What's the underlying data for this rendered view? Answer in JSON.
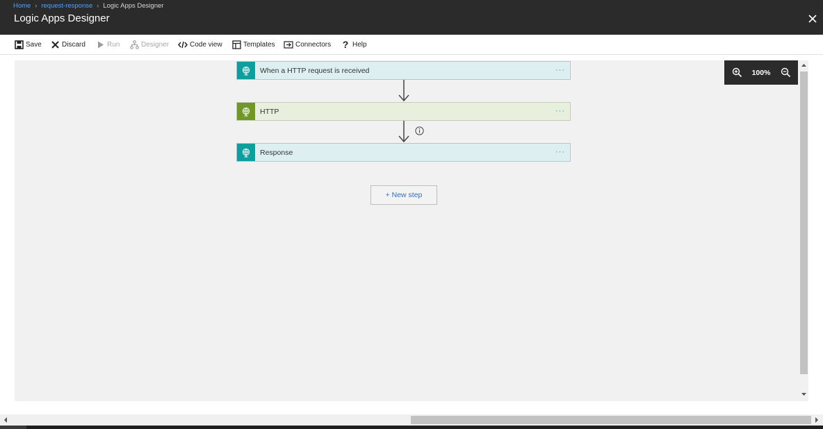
{
  "breadcrumb": {
    "home": "Home",
    "app": "request-response",
    "current": "Logic Apps Designer"
  },
  "title": "Logic Apps Designer",
  "toolbar": {
    "save": "Save",
    "discard": "Discard",
    "run": "Run",
    "designer": "Designer",
    "code_view": "Code view",
    "templates": "Templates",
    "connectors": "Connectors",
    "help": "Help"
  },
  "steps": [
    {
      "title": "When a HTTP request is received",
      "icon": "http-request-trigger-icon",
      "color": "#0f9e9e"
    },
    {
      "title": "HTTP",
      "icon": "http-action-icon",
      "color": "#709727"
    },
    {
      "title": "Response",
      "icon": "response-icon",
      "color": "#0f9e9e"
    }
  ],
  "step_menu": "···",
  "new_step": "+ New step",
  "zoom": {
    "level": "100%"
  },
  "colors": {
    "header_bg": "#2b2b2b",
    "link": "#4da3ff",
    "teal": "#0f9e9e",
    "green": "#709727",
    "new_step_text": "#2f6fb5"
  }
}
